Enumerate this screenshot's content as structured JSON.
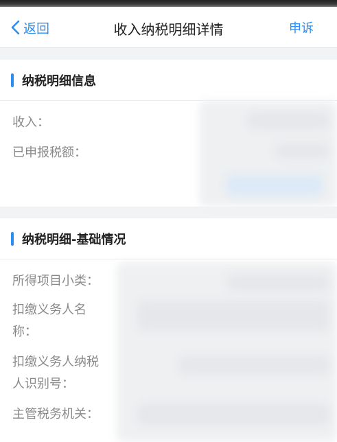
{
  "navbar": {
    "back_label": "返回",
    "title": "收入纳税明细详情",
    "appeal_label": "申诉"
  },
  "section1": {
    "title": "纳税明细信息",
    "rows": [
      {
        "label": "收入："
      },
      {
        "label": "已申报税额："
      }
    ]
  },
  "section2": {
    "title": "纳税明细-基础情况",
    "rows": [
      {
        "label": "所得项目小类："
      },
      {
        "label_line1": "扣缴义务人名",
        "label_line2": "称："
      },
      {
        "label_line1": "扣缴义务人纳税",
        "label_line2": "人识别号："
      },
      {
        "label": "主管税务机关："
      }
    ]
  },
  "colors": {
    "accent": "#2b8ef2",
    "background": "#f2f3f5"
  }
}
